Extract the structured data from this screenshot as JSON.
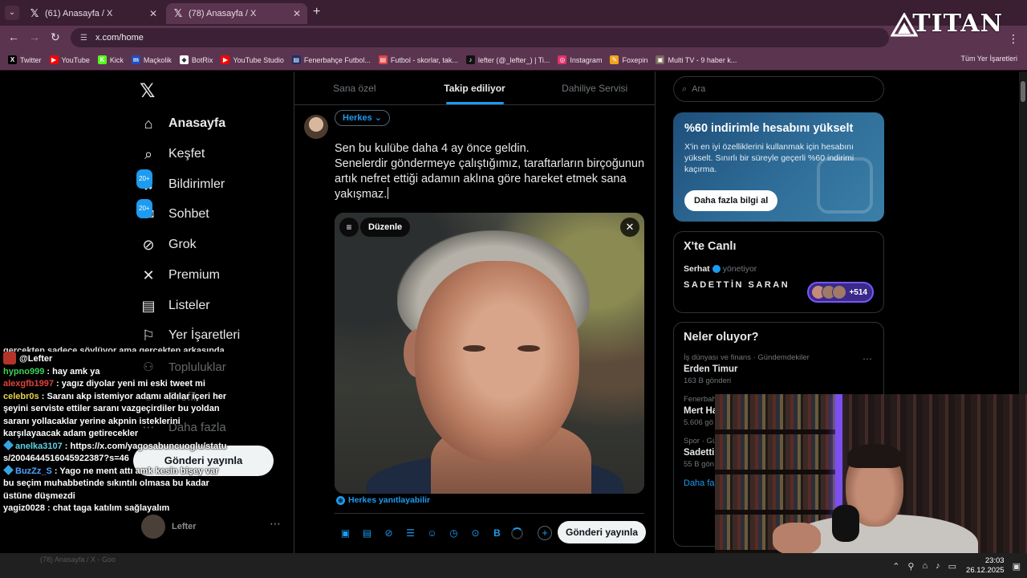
{
  "browser": {
    "tabs": [
      {
        "title": "(61) Anasayfa / X"
      },
      {
        "title": "(78) Anasayfa / X"
      }
    ],
    "url": "x.com/home",
    "overlay_logo": "TITAN",
    "bookmarks": [
      {
        "label": "Twitter",
        "color": "#000000",
        "glyph": "X"
      },
      {
        "label": "YouTube",
        "color": "#ff0000",
        "glyph": "▶"
      },
      {
        "label": "Kick",
        "color": "#53fc18",
        "glyph": "K"
      },
      {
        "label": "Maçkolik",
        "color": "#1f4fbf",
        "glyph": "m"
      },
      {
        "label": "BotRix",
        "color": "#ffffff",
        "glyph": "◆"
      },
      {
        "label": "YouTube Studio",
        "color": "#ff0000",
        "glyph": "▶"
      },
      {
        "label": "Fenerbahçe Futbol...",
        "color": "#1a2f6b",
        "glyph": "▤"
      },
      {
        "label": "Futbol - skorlar, tak...",
        "color": "#d44",
        "glyph": "▤"
      },
      {
        "label": "lefter (@_lefter_) | Ti...",
        "color": "#111111",
        "glyph": "♪"
      },
      {
        "label": "Instagram",
        "color": "#e1306c",
        "glyph": "◎"
      },
      {
        "label": "Foxepin",
        "color": "#f2a51c",
        "glyph": "✎"
      },
      {
        "label": "Multi TV - 9 haber k...",
        "color": "#7a6a5a",
        "glyph": "▣"
      }
    ],
    "all_bookmarks": "Tüm Yer İşaretleri"
  },
  "nav": {
    "items": [
      {
        "label": "Anasayfa",
        "icon": "home-icon",
        "glyph": "⌂"
      },
      {
        "label": "Keşfet",
        "icon": "search-icon",
        "glyph": "⌕"
      },
      {
        "label": "Bildirimler",
        "icon": "bell-icon",
        "glyph": "♫",
        "badge": "20+"
      },
      {
        "label": "Sohbet",
        "icon": "mail-icon",
        "glyph": "✉",
        "badge": "20+"
      },
      {
        "label": "Grok",
        "icon": "grok-icon",
        "glyph": "⊘"
      },
      {
        "label": "Premium",
        "icon": "x-icon",
        "glyph": "✕"
      },
      {
        "label": "Listeler",
        "icon": "list-icon",
        "glyph": "▤"
      },
      {
        "label": "Yer İşaretleri",
        "icon": "bookmark-icon",
        "glyph": "⚐"
      },
      {
        "label": "Topluluklar",
        "icon": "communities-icon",
        "glyph": "⚇"
      },
      {
        "label": "Profil",
        "icon": "profile-icon",
        "glyph": "☺"
      },
      {
        "label": "Daha fazla",
        "icon": "more-icon",
        "glyph": "⋯"
      }
    ],
    "post_button": "Gönderi yayınla",
    "account_name": "Lefter"
  },
  "feed": {
    "tabs": [
      "Sana özel",
      "Takip ediliyor",
      "Dahiliye Servisi"
    ],
    "active_tab": 1,
    "audience": "Herkes",
    "compose_text": "Sen bu kulübe daha 4 ay önce geldin.\nSenelerdir göndermeye çalıştığımız, taraftarların birçoğunun artık nefret ettiği adamın aklına göre hareket etmek sana yakışmaz.",
    "media_edit_label": "Düzenle",
    "reply_scope": "Herkes yanıtlayabilir",
    "post_button": "Gönderi yayınla"
  },
  "sidebar": {
    "search_placeholder": "Ara",
    "promo": {
      "title": "%60 indirimle hesabını yükselt",
      "body": "X'in en iyi özelliklerini kullanmak için hesabını yükselt. Sınırlı bir süreyle geçerli %60 indirimi kaçırma.",
      "button": "Daha fazla bilgi al"
    },
    "live": {
      "title": "X'te Canlı",
      "host": "Serhat",
      "role": "yönetiyor",
      "space_name": "SADETTİN SARAN",
      "listeners": "+514"
    },
    "trends": {
      "title": "Neler oluyor?",
      "items": [
        {
          "category": "İş dünyası ve finans · Gündemdekiler",
          "name": "Erden Timur",
          "count": "163 B gönderi"
        },
        {
          "category": "Fenerbah",
          "name": "Mert Ha",
          "count": "5.606 gö"
        },
        {
          "category": "Spor · Gü",
          "name": "Sadetti",
          "count": "55 B gön"
        }
      ],
      "more": "Daha fa"
    }
  },
  "chat": {
    "messages": [
      {
        "user": "",
        "text": "gerçekten sadece söylüyor ama gerçekten arkasında"
      },
      {
        "user": "@Lefter",
        "text": "",
        "color": "#ffffff",
        "emote": true
      },
      {
        "user": "hypno999",
        "text": "hay amk ya",
        "color": "#3ad15a"
      },
      {
        "user": "alexgfb1997",
        "text": "yagız diyolar yeni mi eski tweet mi",
        "color": "#e0433c"
      },
      {
        "user": "celebr0s",
        "text": "Saranı akp istemiyor adamı aldılar içeri her şeyini serviste ettiler saranı vazgeçirdiler bu yoldan saranı yollacaklar yerine akpnin isteklerini karşılayaacak adam getirecekler",
        "color": "#e7d54a"
      },
      {
        "user": "anelka3107",
        "text": "https://x.com/yagosabuncuoglu/status/2004644516045922387?s=46",
        "color": "#5fd3e6",
        "gem": true
      },
      {
        "user": "BuzZz_S",
        "text": "Yago ne ment attı amk kesin bişey var bu seçim muhabbetinde sıkıntılı olmasa bu kadar üstüne düşmezdi",
        "color": "#4da3ff",
        "gem": true
      },
      {
        "user": "yagiz0028",
        "text": "chat taga katılım sağlayalım",
        "color": "#ffffff"
      }
    ]
  },
  "taskbar": {
    "app_title": "(78) Anasayfa / X - Goo",
    "time": "23:03",
    "date": "26.12.2025"
  }
}
